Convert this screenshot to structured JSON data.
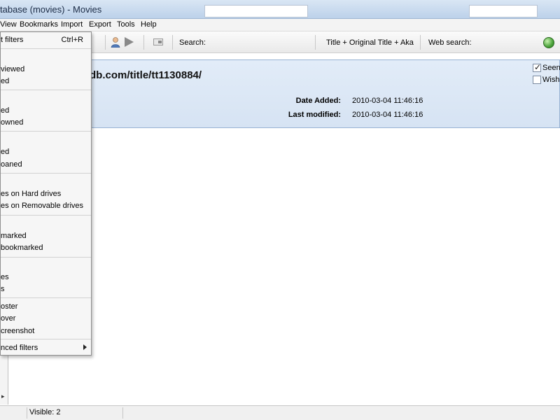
{
  "window": {
    "title": "tabase (movies) - Movies"
  },
  "menu": {
    "view": "View",
    "bookmarks": "Bookmarks",
    "import": "Import",
    "export": "Export",
    "tools": "Tools",
    "help": "Help"
  },
  "toolbar": {
    "search_label": "Search:",
    "search_value": "",
    "search_scope": "Title + Original Title + Aka",
    "web_search_label": "Web search:",
    "web_search_value": ""
  },
  "detail": {
    "url": "db.com/title/tt1130884/",
    "date_added_label": "Date Added:",
    "date_added_value": "2010-03-04 11:46:16",
    "last_modified_label": "Last modified:",
    "last_modified_value": "2010-03-04 11:46:16",
    "seen_label": "Seen",
    "seen_checked": true,
    "wish_label": "Wish",
    "wish_checked": false
  },
  "filter_menu": {
    "items": [
      {
        "label": "t filters",
        "shortcut": "Ctrl+R"
      },
      {
        "label": "viewed"
      },
      {
        "label": "ed"
      },
      {
        "label": "ed"
      },
      {
        "label": "owned"
      },
      {
        "label": "ed"
      },
      {
        "label": "oaned"
      },
      {
        "label": "es on Hard drives"
      },
      {
        "label": "es on Removable drives"
      },
      {
        "label": "marked"
      },
      {
        "label": "bookmarked"
      },
      {
        "label": "es"
      },
      {
        "label": "s"
      },
      {
        "label": "oster"
      },
      {
        "label": "over"
      },
      {
        "label": "creenshot"
      },
      {
        "label": "nced filters"
      }
    ]
  },
  "status": {
    "visible": "Visible: 2"
  }
}
